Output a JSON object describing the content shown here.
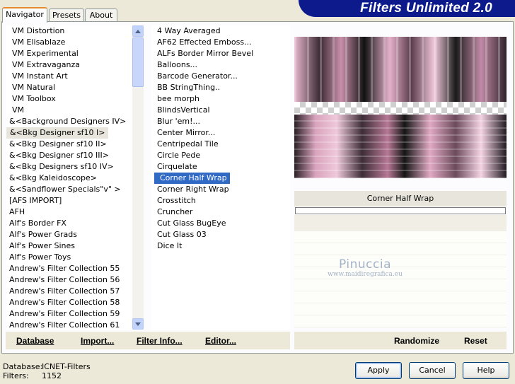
{
  "brand": {
    "title": "Filters Unlimited 2.0"
  },
  "tabs": [
    {
      "label": "Navigator"
    },
    {
      "label": "Presets"
    },
    {
      "label": "About"
    }
  ],
  "categories": [
    "VM Distortion",
    "VM Elisablaze",
    "VM Experimental",
    "VM Extravaganza",
    "VM Instant Art",
    "VM Natural",
    "VM Toolbox",
    "VM",
    "&<Background Designers IV>",
    "&<Bkg Designer sf10 I>",
    "&<Bkg Designer sf10 II>",
    "&<Bkg Designer sf10 III>",
    "&<Bkg Designers sf10 IV>",
    "&<Bkg Kaleidoscope>",
    "&<Sandflower Specials\"v\" >",
    "[AFS IMPORT]",
    "AFH",
    "Alf's Border FX",
    "Alf's Power Grads",
    "Alf's Power Sines",
    "Alf's Power Toys",
    "Andrew's Filter Collection 55",
    "Andrew's Filter Collection 56",
    "Andrew's Filter Collection 57",
    "Andrew's Filter Collection 58",
    "Andrew's Filter Collection 59",
    "Andrew's Filter Collection 61"
  ],
  "filters": [
    "4 Way Averaged",
    "AF62 Effected Emboss...",
    "ALFs Border Mirror Bevel",
    "Balloons...",
    "Barcode Generator...",
    "BB StringThing..",
    "bee morph",
    "BlindsVertical",
    "Blur 'em!...",
    "Center Mirror...",
    "Centripedal Tile",
    "Circle Pede",
    "Cirquelate",
    "Corner Half Wrap",
    "Corner Right Wrap",
    "Crosstitch",
    "Cruncher",
    "Cut Glass  BugEye",
    "Cut Glass 03",
    "Dice It"
  ],
  "selected_category": "&<Bkg Designer sf10 I>",
  "selected_filter": "Corner Half Wrap",
  "preview": {
    "filter_name": "Corner Half Wrap"
  },
  "watermark": {
    "title": "Pinuccia",
    "subtitle": "www.maidiregrafica.eu"
  },
  "toolbar": {
    "database": "Database",
    "import": "Import...",
    "filter_info": "Filter Info...",
    "editor": "Editor...",
    "randomize": "Randomize",
    "reset": "Reset"
  },
  "status": {
    "database_label": "Database:",
    "database_value": "ICNET-Filters",
    "filters_label": "Filters:",
    "filters_value": "1152"
  },
  "buttons": {
    "apply": "Apply",
    "cancel": "Cancel",
    "help": "Help"
  }
}
